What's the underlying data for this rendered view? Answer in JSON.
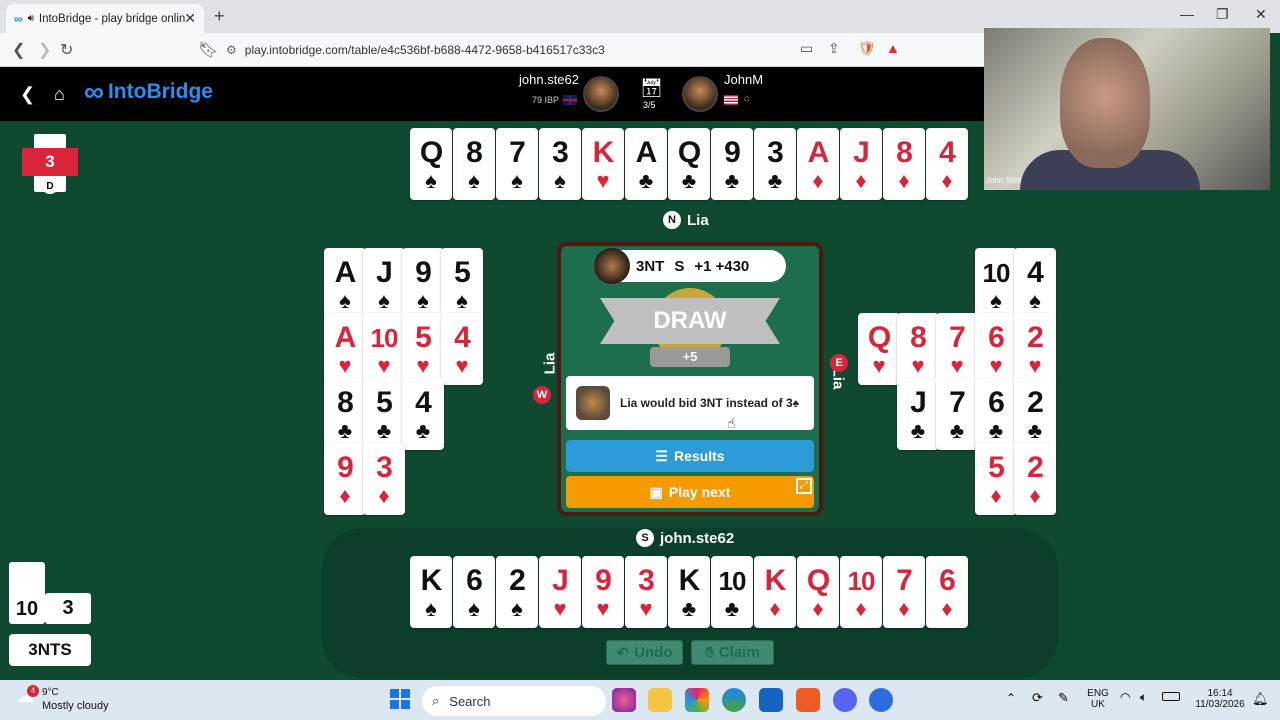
{
  "browser": {
    "tab_title": "IntoBridge - play bridge onlin",
    "url": "play.intobridge.com/table/e4c536bf-b688-4472-9658-b416517c33c3"
  },
  "app": {
    "brand": "IntoBridge",
    "player_left": {
      "name": "john.ste62",
      "ibp": "79 IBP"
    },
    "board_count": "3/5",
    "player_right": {
      "name": "JohnM"
    }
  },
  "webcam": {
    "name": "John Stell"
  },
  "seats": {
    "north": {
      "badge": "N",
      "name": "Lia"
    },
    "west": {
      "badge": "W",
      "name": "Lia"
    },
    "east": {
      "badge": "E",
      "name": "Lia"
    },
    "south": {
      "badge": "S",
      "name": "john.ste62"
    }
  },
  "north_cards": [
    {
      "rank": "Q",
      "suit": "♠",
      "color": "blk"
    },
    {
      "rank": "8",
      "suit": "♠",
      "color": "blk"
    },
    {
      "rank": "7",
      "suit": "♠",
      "color": "blk"
    },
    {
      "rank": "3",
      "suit": "♠",
      "color": "blk"
    },
    {
      "rank": "K",
      "suit": "♥",
      "color": "red"
    },
    {
      "rank": "A",
      "suit": "♣",
      "color": "blk"
    },
    {
      "rank": "Q",
      "suit": "♣",
      "color": "blk"
    },
    {
      "rank": "9",
      "suit": "♣",
      "color": "blk"
    },
    {
      "rank": "3",
      "suit": "♣",
      "color": "blk"
    },
    {
      "rank": "A",
      "suit": "♦",
      "color": "red"
    },
    {
      "rank": "J",
      "suit": "♦",
      "color": "red"
    },
    {
      "rank": "8",
      "suit": "♦",
      "color": "red"
    },
    {
      "rank": "4",
      "suit": "♦",
      "color": "red"
    }
  ],
  "south_cards": [
    {
      "rank": "K",
      "suit": "♠",
      "color": "blk"
    },
    {
      "rank": "6",
      "suit": "♠",
      "color": "blk"
    },
    {
      "rank": "2",
      "suit": "♠",
      "color": "blk"
    },
    {
      "rank": "J",
      "suit": "♥",
      "color": "red"
    },
    {
      "rank": "9",
      "suit": "♥",
      "color": "red"
    },
    {
      "rank": "3",
      "suit": "♥",
      "color": "red"
    },
    {
      "rank": "K",
      "suit": "♣",
      "color": "blk"
    },
    {
      "rank": "10",
      "suit": "♣",
      "color": "blk"
    },
    {
      "rank": "K",
      "suit": "♦",
      "color": "red"
    },
    {
      "rank": "Q",
      "suit": "♦",
      "color": "red"
    },
    {
      "rank": "10",
      "suit": "♦",
      "color": "red"
    },
    {
      "rank": "7",
      "suit": "♦",
      "color": "red"
    },
    {
      "rank": "6",
      "suit": "♦",
      "color": "red"
    }
  ],
  "west_rows": [
    [
      {
        "rank": "A",
        "suit": "♠",
        "color": "blk"
      },
      {
        "rank": "J",
        "suit": "♠",
        "color": "blk"
      },
      {
        "rank": "9",
        "suit": "♠",
        "color": "blk"
      },
      {
        "rank": "5",
        "suit": "♠",
        "color": "blk"
      }
    ],
    [
      {
        "rank": "A",
        "suit": "♥",
        "color": "red"
      },
      {
        "rank": "10",
        "suit": "♥",
        "color": "red"
      },
      {
        "rank": "5",
        "suit": "♥",
        "color": "red"
      },
      {
        "rank": "4",
        "suit": "♥",
        "color": "red"
      }
    ],
    [
      {
        "rank": "8",
        "suit": "♣",
        "color": "blk"
      },
      {
        "rank": "5",
        "suit": "♣",
        "color": "blk"
      },
      {
        "rank": "4",
        "suit": "♣",
        "color": "blk"
      }
    ],
    [
      {
        "rank": "9",
        "suit": "♦",
        "color": "red"
      },
      {
        "rank": "3",
        "suit": "♦",
        "color": "red"
      }
    ]
  ],
  "east_rows": [
    [
      {
        "rank": "10",
        "suit": "♠",
        "color": "blk"
      },
      {
        "rank": "4",
        "suit": "♠",
        "color": "blk"
      }
    ],
    [
      {
        "rank": "Q",
        "suit": "♥",
        "color": "red"
      },
      {
        "rank": "8",
        "suit": "♥",
        "color": "red"
      },
      {
        "rank": "7",
        "suit": "♥",
        "color": "red"
      },
      {
        "rank": "6",
        "suit": "♥",
        "color": "red"
      },
      {
        "rank": "2",
        "suit": "♥",
        "color": "red"
      }
    ],
    [
      {
        "rank": "J",
        "suit": "♣",
        "color": "blk"
      },
      {
        "rank": "7",
        "suit": "♣",
        "color": "blk"
      },
      {
        "rank": "6",
        "suit": "♣",
        "color": "blk"
      },
      {
        "rank": "2",
        "suit": "♣",
        "color": "blk"
      }
    ],
    [
      {
        "rank": "5",
        "suit": "♦",
        "color": "red"
      },
      {
        "rank": "2",
        "suit": "♦",
        "color": "red"
      }
    ]
  ],
  "result": {
    "contract": "3NT",
    "declarer": "S",
    "over": "+1",
    "score": "+430",
    "outcome": "DRAW",
    "points": "+5",
    "message": "Lia would bid 3NT instead of 3♠",
    "results_label": "Results",
    "play_next_label": "Play next"
  },
  "actions": {
    "undo": "Undo",
    "claim": "Claim"
  },
  "board_info": {
    "board": "3",
    "dealer": "D"
  },
  "tricks": {
    "ns": "10",
    "ew": "3"
  },
  "contract_box": "3NTS",
  "taskbar": {
    "weather_temp": "9°C",
    "weather_desc": "Mostly cloudy",
    "weather_badge": "4",
    "search": "Search",
    "lang": "ENG",
    "region": "UK",
    "time": "16:14",
    "date": "11/03/2026"
  }
}
